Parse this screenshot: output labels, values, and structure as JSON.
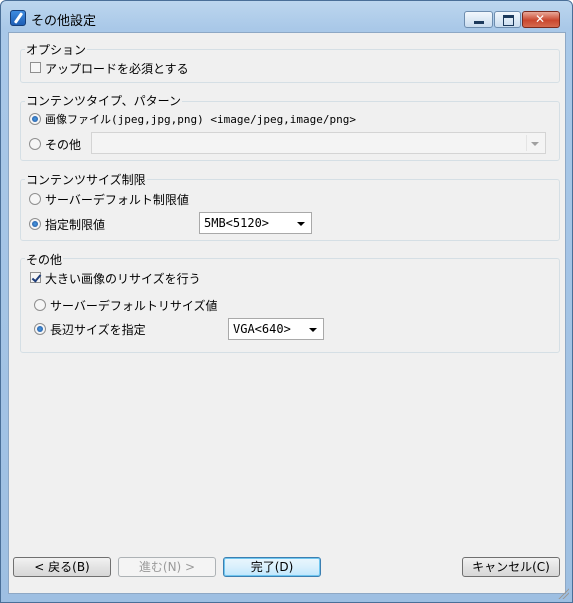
{
  "window": {
    "title": "その他設定"
  },
  "options": {
    "legend": "オプション",
    "require_upload": {
      "label": "アップロードを必須とする",
      "checked": false
    }
  },
  "content_type": {
    "legend": "コンテンツタイプ、パターン",
    "image_option": {
      "label": "画像ファイル(jpeg,jpg,png) <image/jpeg,image/png>",
      "checked": true
    },
    "other_option": {
      "label": "その他",
      "checked": false
    },
    "other_value": ""
  },
  "size_limit": {
    "legend": "コンテンツサイズ制限",
    "server_default": {
      "label": "サーバーデフォルト制限値",
      "checked": false
    },
    "specified": {
      "label": "指定制限値",
      "checked": true
    },
    "specified_value": "5MB<5120>"
  },
  "other": {
    "legend": "その他",
    "resize_large": {
      "label": "大きい画像のリサイズを行う",
      "checked": true
    },
    "server_default_resize": {
      "label": "サーバーデフォルトリサイズ値",
      "checked": false
    },
    "long_side": {
      "label": "長辺サイズを指定",
      "checked": true
    },
    "long_side_value": "VGA<640>"
  },
  "buttons": {
    "back": "< 戻る(B)",
    "next": "進む(N) >",
    "finish": "完了(D)",
    "cancel": "キャンセル(C)"
  },
  "icons": [
    "app-icon",
    "minimize-icon",
    "maximize-icon",
    "close-icon",
    "dropdown-arrow-icon",
    "resize-grip-icon"
  ]
}
